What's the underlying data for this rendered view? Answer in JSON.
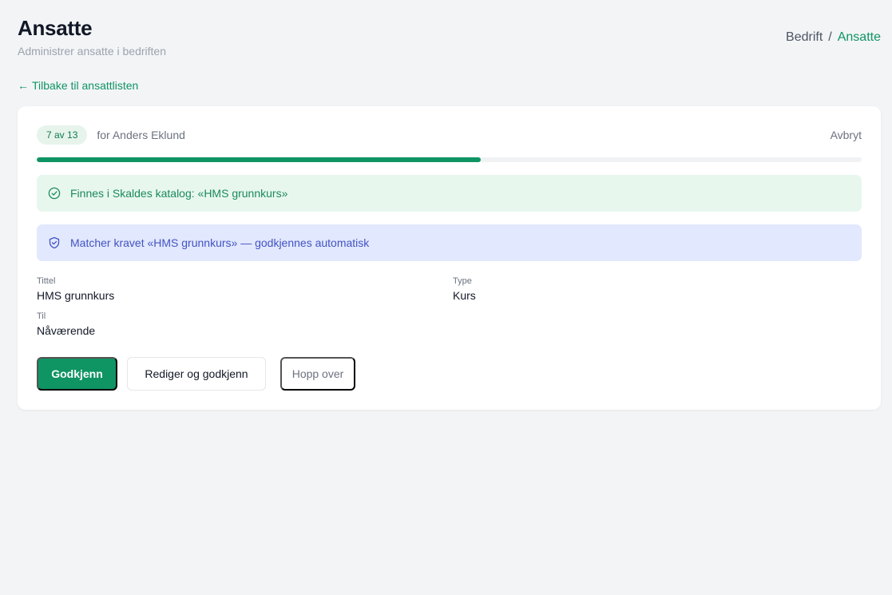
{
  "header": {
    "title": "Ansatte",
    "subtitle": "Administrer ansatte i bedriften"
  },
  "breadcrumb": {
    "parent": "Bedrift",
    "separator": "/",
    "current": "Ansatte"
  },
  "back_link": {
    "arrow": "←",
    "label": "Tilbake til ansattlisten"
  },
  "wizard": {
    "step_badge": "7 av 13",
    "for_label": "for Anders Eklund",
    "cancel_label": "Avbryt",
    "progress_fraction": 0.538
  },
  "alerts": {
    "catalog": "Finnes i Skaldes katalog: «HMS grunnkurs»",
    "requirement": "Matcher kravet «HMS grunnkurs» — godkjennes automatisk"
  },
  "fields": {
    "title_label": "Tittel",
    "title_value": "HMS grunnkurs",
    "type_label": "Type",
    "type_value": "Kurs",
    "to_label": "Til",
    "to_value": "Nåværende"
  },
  "actions": {
    "approve": "Godkjenn",
    "edit_approve": "Rediger og godkjenn",
    "skip": "Hopp over"
  },
  "colors": {
    "accent": "#0f9463",
    "success_bg": "#e8f7ee",
    "info_bg": "#e2e8fd"
  }
}
